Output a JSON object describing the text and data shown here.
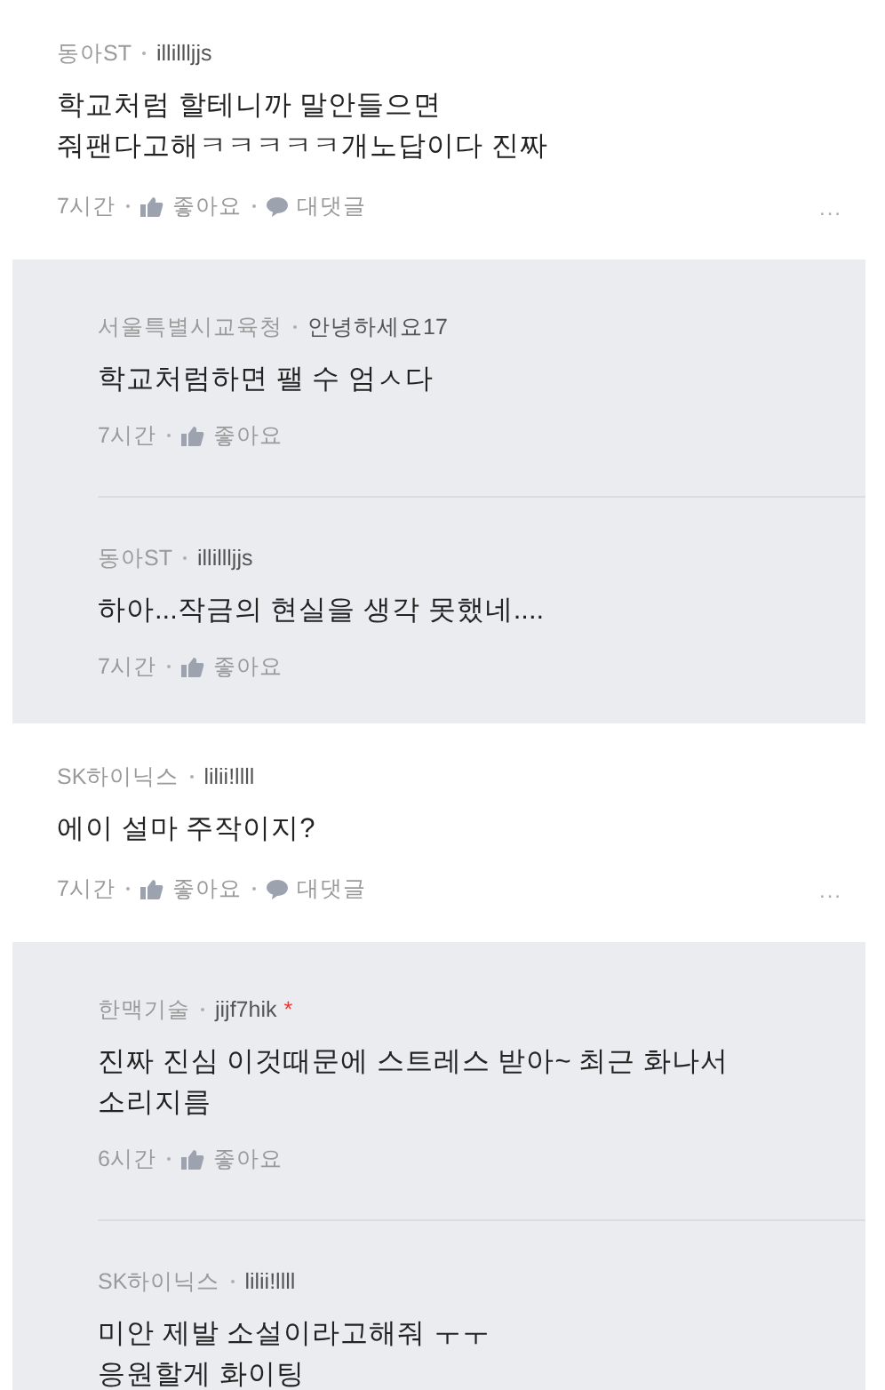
{
  "comments": [
    {
      "org": "동아ST",
      "user": "illillljjs",
      "lines": [
        "학교처럼 할테니까 말안들으면",
        "줘팬다고해ㅋㅋㅋㅋㅋ개노답이다 진짜"
      ],
      "time": "7시간",
      "like": "좋아요",
      "reply": "대댓글",
      "more": "...",
      "replies": [
        {
          "org": "서울특별시교육청",
          "user": "안녕하세요17",
          "lines": [
            "학교처럼하면 팰 수 엄ㅅ다"
          ],
          "time": "7시간",
          "like": "좋아요"
        },
        {
          "org": "동아ST",
          "user": "illillljjs",
          "lines": [
            "하아...작금의 현실을 생각 못했네...."
          ],
          "time": "7시간",
          "like": "좋아요"
        }
      ]
    },
    {
      "org": "SK하이닉스",
      "user": "lilii!llll",
      "lines": [
        "에이 설마 주작이지?"
      ],
      "time": "7시간",
      "like": "좋아요",
      "reply": "대댓글",
      "more": "...",
      "replies": [
        {
          "org": "한맥기술",
          "user": "jijf7hik",
          "marker": "*",
          "lines": [
            "진짜 진심 이것때문에 스트레스 받아~ 최근 화나서",
            "소리지름"
          ],
          "time": "6시간",
          "like": "좋아요"
        },
        {
          "org": "SK하이닉스",
          "user": "lilii!llll",
          "lines": [
            "미안 제발 소설이라고해줘 ㅜㅜ",
            "응원할게 화이팅"
          ]
        }
      ]
    }
  ]
}
